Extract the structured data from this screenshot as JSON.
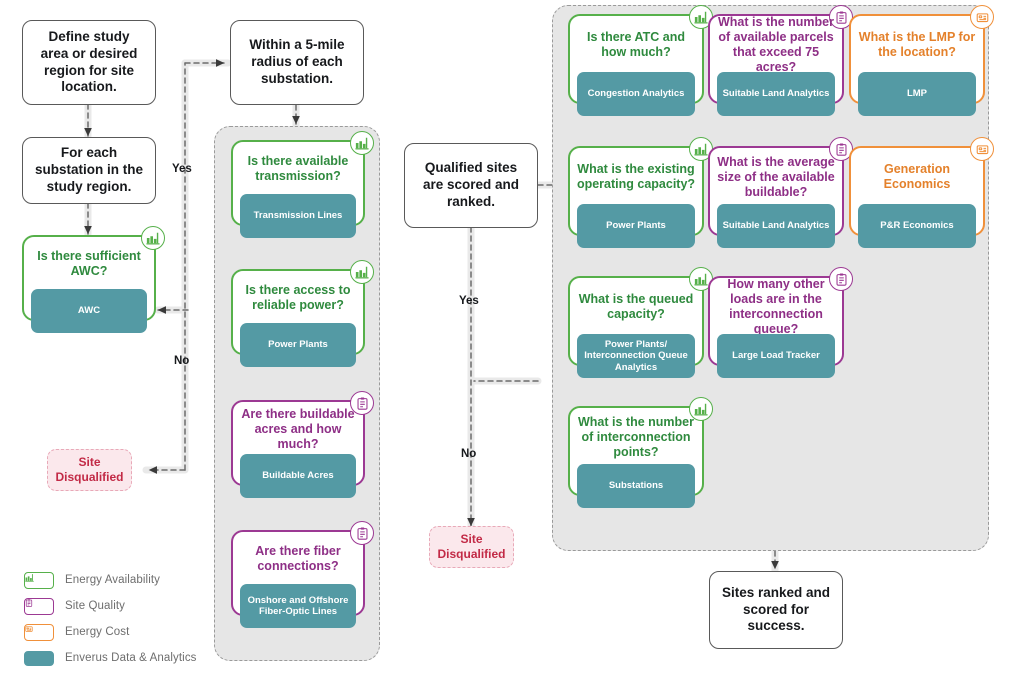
{
  "diagram": {
    "title": "Data center site selection workflow",
    "colors": {
      "energy_availability": "#56b04a",
      "site_quality": "#9c3993",
      "energy_cost": "#f0903a",
      "enverus_data": "#549aa4",
      "disqualified_text": "#c22a46",
      "disqualified_fill": "#fbe8ec",
      "group_fill": "#e6e6e6",
      "process_border": "#595959"
    },
    "process_boxes": [
      {
        "id": "define",
        "text": "Define study area or desired region for site location."
      },
      {
        "id": "for_each",
        "text": "For each substation in the study region."
      },
      {
        "id": "radius",
        "text": "Within a 5-mile radius of each substation."
      },
      {
        "id": "qualified",
        "text": "Qualified sites are scored and ranked."
      },
      {
        "id": "ranked",
        "text": "Sites ranked and scored for success."
      }
    ],
    "terminals": [
      {
        "id": "dq1",
        "text": "Site Disqualified"
      },
      {
        "id": "dq2",
        "text": "Site Disqualified"
      }
    ],
    "edge_labels": [
      {
        "id": "yes1",
        "text": "Yes"
      },
      {
        "id": "no1",
        "text": "No"
      },
      {
        "id": "yes2",
        "text": "Yes"
      },
      {
        "id": "no2",
        "text": "No"
      }
    ],
    "cards": [
      {
        "id": "awc",
        "question": "Is there sufficient AWC?",
        "pill": "AWC",
        "category": "energy_availability",
        "icon": "power-plant-icon"
      },
      {
        "id": "transmission",
        "question": "Is there available transmission?",
        "pill": "Transmission Lines",
        "category": "energy_availability",
        "icon": "power-plant-icon"
      },
      {
        "id": "reliable",
        "question": "Is there access to reliable power?",
        "pill": "Power Plants",
        "category": "energy_availability",
        "icon": "power-plant-icon"
      },
      {
        "id": "buildable",
        "question": "Are there buildable acres and how much?",
        "pill": "Buildable Acres",
        "category": "site_quality",
        "icon": "clipboard-icon"
      },
      {
        "id": "fiber",
        "question": "Are there fiber connections?",
        "pill": "Onshore and Offshore Fiber-Optic Lines",
        "category": "site_quality",
        "icon": "clipboard-icon"
      },
      {
        "id": "atc",
        "question": "Is there ATC and how much?",
        "pill": "Congestion Analytics",
        "category": "energy_availability",
        "icon": "power-plant-icon"
      },
      {
        "id": "parcels",
        "question": "What is the number of available parcels that exceed 75 acres?",
        "pill": "Suitable Land Analytics",
        "category": "site_quality",
        "icon": "clipboard-icon"
      },
      {
        "id": "lmp",
        "question": "What is the LMP for the location?",
        "pill": "LMP",
        "category": "energy_cost",
        "icon": "money-icon"
      },
      {
        "id": "operating",
        "question": "What is the existing operating capacity?",
        "pill": "Power Plants",
        "category": "energy_availability",
        "icon": "power-plant-icon"
      },
      {
        "id": "avgsize",
        "question": "What is the average size of the available buildable?",
        "pill": "Suitable Land Analytics",
        "category": "site_quality",
        "icon": "clipboard-icon"
      },
      {
        "id": "genecon",
        "question": "Generation Economics",
        "pill": "P&R Economics",
        "category": "energy_cost",
        "icon": "money-icon"
      },
      {
        "id": "queued",
        "question": "What is the queued capacity?",
        "pill": "Power Plants/ Interconnection Queue Analytics",
        "category": "energy_availability",
        "icon": "power-plant-icon"
      },
      {
        "id": "otherloads",
        "question": "How many other loads are in the interconnection queue?",
        "pill": "Large Load Tracker",
        "category": "site_quality",
        "icon": "clipboard-icon"
      },
      {
        "id": "interpoints",
        "question": "What is the number of interconnection points?",
        "pill": "Substations",
        "category": "energy_availability",
        "icon": "power-plant-icon"
      }
    ],
    "legend": [
      {
        "id": "legend-energy-availability",
        "label": "Energy Availability",
        "category": "energy_availability",
        "icon": "power-plant-icon"
      },
      {
        "id": "legend-site-quality",
        "label": "Site Quality",
        "category": "site_quality",
        "icon": "clipboard-icon"
      },
      {
        "id": "legend-energy-cost",
        "label": "Energy Cost",
        "category": "energy_cost",
        "icon": "money-icon"
      },
      {
        "id": "legend-enverus",
        "label": "Enverus Data & Analytics",
        "category": "enverus_data",
        "icon": "solid-swatch"
      }
    ]
  }
}
